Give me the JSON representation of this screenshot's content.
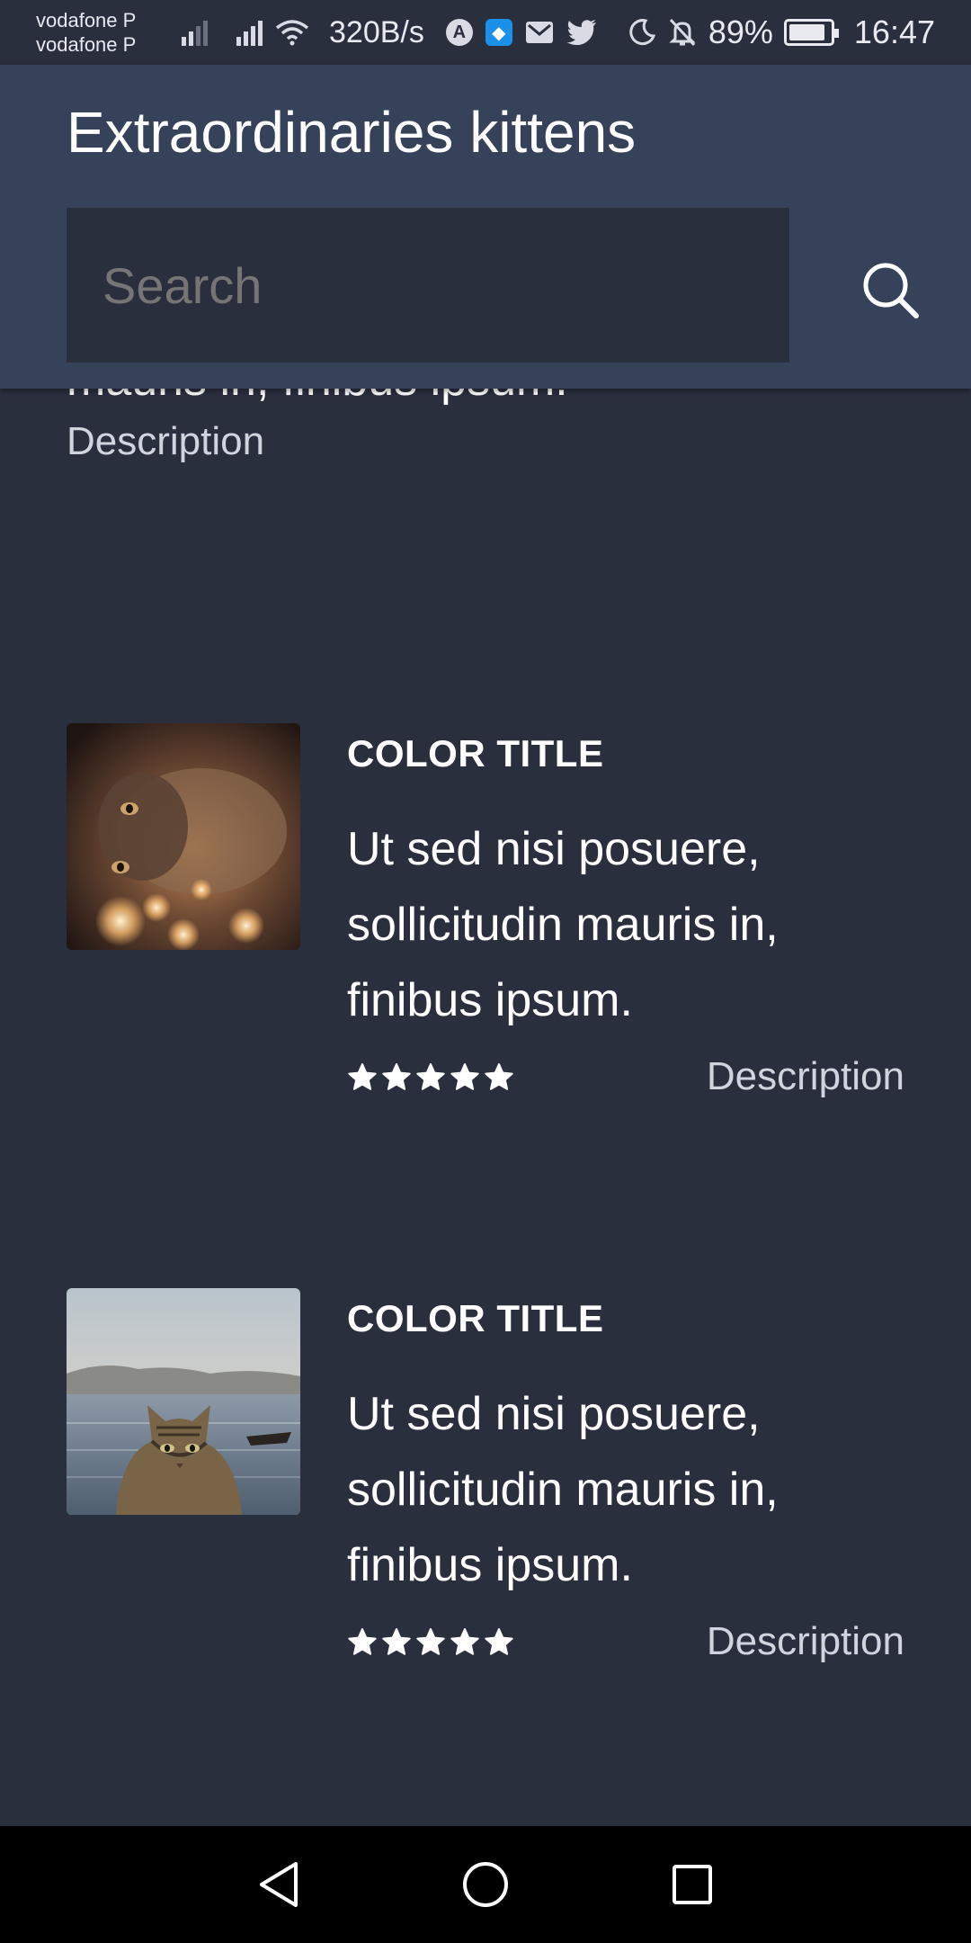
{
  "status_bar": {
    "carrier_1": "vodafone P",
    "carrier_2": "vodafone P",
    "net_speed": "320B/s",
    "battery": "89%",
    "battery_level": 0.89,
    "time": "16:47",
    "icons": [
      "signal-icon",
      "signal-icon",
      "wifi-icon",
      "app-icon",
      "shield-icon",
      "mail-icon",
      "twitter-icon",
      "moon-icon",
      "bell-off-icon",
      "battery-icon"
    ]
  },
  "header": {
    "title": "Extraordinaries kittens",
    "search_placeholder": "Search",
    "background": "#364259"
  },
  "partial_item": {
    "text": "mauris in, finibus ipsum.",
    "description": "Description"
  },
  "items": [
    {
      "image": "kitten-with-lights",
      "title": "COLOR TITLE",
      "text": "Ut sed nisi posuere, sollicitudin mauris in, finibus ipsum.",
      "rating": 5,
      "description": "Description"
    },
    {
      "image": "kitten-by-lake",
      "title": "COLOR TITLE",
      "text": "Ut sed nisi posuere, sollicitudin mauris in, finibus ipsum.",
      "rating": 5,
      "description": "Description"
    }
  ],
  "navigation": {
    "buttons": [
      "back-icon",
      "home-icon",
      "recents-icon"
    ]
  },
  "colors": {
    "background": "#2a2f3e",
    "header": "#364259",
    "text": "#ffffff",
    "muted": "#d0d4dc"
  }
}
